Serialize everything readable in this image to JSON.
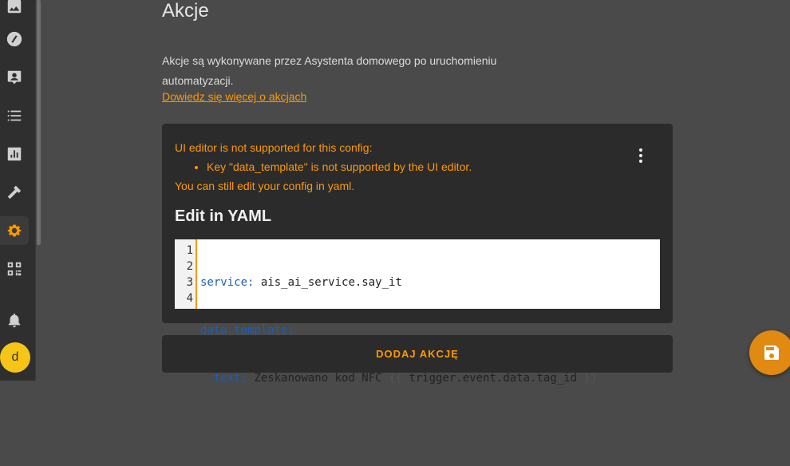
{
  "page": {
    "heading": "Akcje",
    "description": "Akcje są wykonywane przez Asystenta domowego po uruchomieniu automatyzacji.",
    "learn_more": "Dowiedz się więcej o akcjach"
  },
  "card": {
    "warning_title": "UI editor is not supported for this config:",
    "warning_item": "Key \"data_template\" is not supported by the UI editor.",
    "warning_footer": "You can still edit your config in yaml.",
    "yaml_title": "Edit in YAML",
    "lines": [
      "1",
      "2",
      "3",
      "4"
    ],
    "code": {
      "l1_key": "service:",
      "l1_val": " ais_ai_service.say_it",
      "l2_key": "data_template:",
      "l3_key": "  text:",
      "l3_val": " Zeskanowano kod NFC ",
      "l3_open": "{{",
      "l3_expr": " trigger.event.data.tag_id ",
      "l3_close": "}}"
    }
  },
  "add_action": "DODAJ AKCJĘ",
  "sidebar": {
    "avatar_letter": "d",
    "icons": [
      "image-icon",
      "compass-icon",
      "account-box-icon",
      "list-icon",
      "chart-icon",
      "hammer-icon",
      "gear-icon",
      "qr-code-icon",
      "bell-icon"
    ]
  },
  "colors": {
    "accent": "#ff9800",
    "background": "#4a4a4a",
    "card": "#2b2b2b"
  }
}
